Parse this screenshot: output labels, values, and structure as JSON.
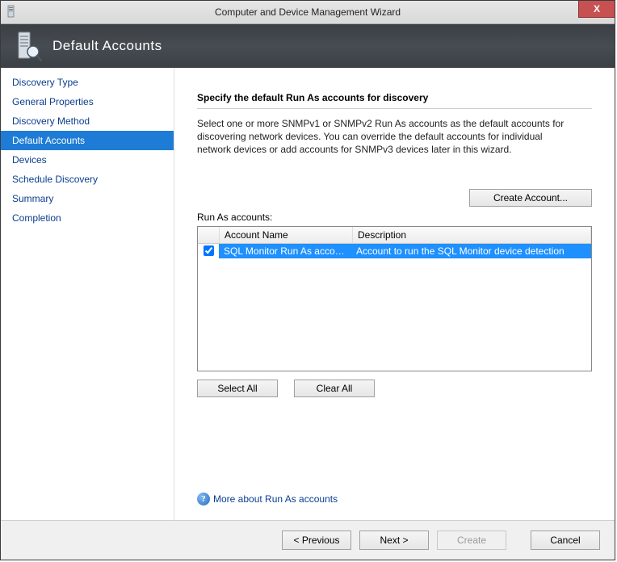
{
  "window": {
    "title": "Computer and Device Management Wizard"
  },
  "banner": {
    "title": "Default Accounts"
  },
  "sidebar": {
    "items": [
      {
        "label": "Discovery Type",
        "active": false
      },
      {
        "label": "General Properties",
        "active": false
      },
      {
        "label": "Discovery Method",
        "active": false
      },
      {
        "label": "Default Accounts",
        "active": true
      },
      {
        "label": "Devices",
        "active": false
      },
      {
        "label": "Schedule Discovery",
        "active": false
      },
      {
        "label": "Summary",
        "active": false
      },
      {
        "label": "Completion",
        "active": false
      }
    ]
  },
  "main": {
    "heading": "Specify the default Run As accounts for discovery",
    "description": "Select one or more SNMPv1 or SNMPv2 Run As accounts as the default accounts for discovering network devices. You can override the default accounts for individual network devices or add accounts for SNMPv3 devices later in this wizard.",
    "create_account_label": "Create Account...",
    "list_label": "Run As accounts:",
    "columns": {
      "name": "Account Name",
      "description": "Description"
    },
    "rows": [
      {
        "checked": true,
        "name": "SQL Monitor Run As account",
        "description": "Account to run the SQL Monitor device detection"
      }
    ],
    "select_all_label": "Select All",
    "clear_all_label": "Clear All",
    "help_link": "More about Run As accounts"
  },
  "footer": {
    "previous": "< Previous",
    "next": "Next >",
    "create": "Create",
    "cancel": "Cancel"
  }
}
